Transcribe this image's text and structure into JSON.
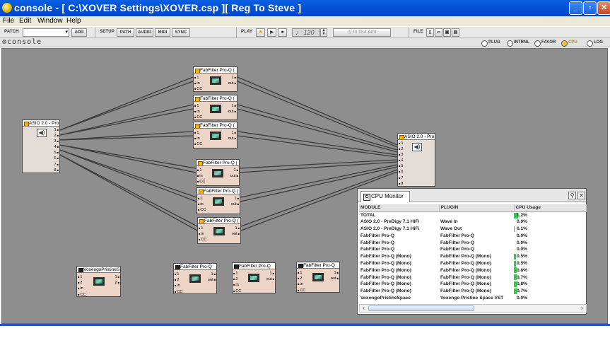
{
  "window": {
    "title": "console - [ C:\\XOVER Settings\\XOVER.csp ][ Reg To Steve ]",
    "buttons": [
      "_",
      "▫",
      "✕"
    ]
  },
  "menu": [
    "File",
    "Edit",
    "Window",
    "Help"
  ],
  "toolbar": {
    "patch_label": "PATCH",
    "add_label": "ADD",
    "setup_label": "SETUP",
    "path_label": "PATH",
    "audio_label": "AUDIO",
    "midi_label": "MIDI",
    "sync_label": "SYNC",
    "play_label": "PLAY",
    "tempo": "♩ 120",
    "inout_label": "In Out Amt",
    "file_label": "FILE"
  },
  "console": {
    "title": "console",
    "tabs": [
      "PLUG",
      "INTRNL",
      "FAVOR",
      "CPU",
      "LOG"
    ],
    "active_tab": "CPU"
  },
  "modules": [
    {
      "id": "asio-in",
      "title": "ASIO 2.0 - Pro",
      "outputs": [
        "1",
        "2",
        "3",
        "4",
        "5",
        "6",
        "7",
        "8"
      ]
    },
    {
      "id": "fab1",
      "title": "FabFilter Pro-Q (",
      "inputs": [
        "1",
        "in",
        "CC"
      ],
      "outputs": [
        "1",
        "out"
      ]
    },
    {
      "id": "fab2",
      "title": "FabFilter Pro-Q (",
      "inputs": [
        "1",
        "in",
        "CC"
      ],
      "outputs": [
        "1",
        "out"
      ]
    },
    {
      "id": "fab3",
      "title": "FabFilter Pro-Q (",
      "inputs": [
        "1",
        "in",
        "CC"
      ],
      "outputs": [
        "1",
        "out"
      ]
    },
    {
      "id": "fab4",
      "title": "FabFilter Pro-Q (",
      "inputs": [
        "1",
        "in",
        "CC"
      ],
      "outputs": [
        "1",
        "out"
      ]
    },
    {
      "id": "fab5",
      "title": "FabFilter Pro-Q (",
      "inputs": [
        "1",
        "in",
        "CC"
      ],
      "outputs": [
        "1",
        "out"
      ]
    },
    {
      "id": "fab6",
      "title": "FabFilter Pro-Q (",
      "inputs": [
        "1",
        "in",
        "CC"
      ],
      "outputs": [
        "1",
        "out"
      ]
    },
    {
      "id": "asio-out",
      "title": "ASIO 2.0 - Pro",
      "inputs": [
        "1",
        "2",
        "3",
        "4",
        "5",
        "6",
        "7",
        "8"
      ]
    },
    {
      "id": "voxengo",
      "title": "VoxengoPristineS",
      "inputs": [
        "1",
        "2",
        "in",
        "CC"
      ],
      "outputs": [
        "1",
        "2"
      ]
    },
    {
      "id": "fab7",
      "title": "FabFilter Pro-Q",
      "inputs": [
        "1",
        "2",
        "in",
        "CC"
      ],
      "outputs": [
        "1",
        "out"
      ]
    },
    {
      "id": "fab8",
      "title": "FabFilter Pro-Q",
      "inputs": [
        "1",
        "2",
        "in",
        "CC"
      ],
      "outputs": [
        "1",
        "out"
      ]
    },
    {
      "id": "fab9",
      "title": "FabFilter Pro-Q",
      "inputs": [
        "1",
        "2",
        "in",
        "CC"
      ],
      "outputs": [
        "1",
        "out"
      ]
    }
  ],
  "cpu_monitor": {
    "title": "CPU Monitor",
    "columns": [
      "MODULE",
      "PLUGIN",
      "CPU Usage"
    ],
    "rows": [
      {
        "module": "TOTAL",
        "plugin": "",
        "usage": "1.2%",
        "pct": 1.2
      },
      {
        "module": "ASIO 2.0 - PreDigy 7.1 HiFi",
        "plugin": "Wave In",
        "usage": "0.0%",
        "pct": 0
      },
      {
        "module": "ASIO 2.0 - PreDigy 7.1 HiFi",
        "plugin": "Wave Out",
        "usage": "0.1%",
        "pct": 0.1
      },
      {
        "module": "FabFilter Pro-Q",
        "plugin": "FabFilter Pro-Q",
        "usage": "0.0%",
        "pct": 0
      },
      {
        "module": "FabFilter Pro-Q",
        "plugin": "FabFilter Pro-Q",
        "usage": "0.0%",
        "pct": 0
      },
      {
        "module": "FabFilter Pro-Q",
        "plugin": "FabFilter Pro-Q",
        "usage": "0.0%",
        "pct": 0
      },
      {
        "module": "FabFilter Pro-Q (Mono)",
        "plugin": "FabFilter Pro-Q (Mono)",
        "usage": "0.5%",
        "pct": 0.5
      },
      {
        "module": "FabFilter Pro-Q (Mono)",
        "plugin": "FabFilter Pro-Q (Mono)",
        "usage": "0.5%",
        "pct": 0.5
      },
      {
        "module": "FabFilter Pro-Q (Mono)",
        "plugin": "FabFilter Pro-Q (Mono)",
        "usage": "0.8%",
        "pct": 0.8
      },
      {
        "module": "FabFilter Pro-Q (Mono)",
        "plugin": "FabFilter Pro-Q (Mono)",
        "usage": "0.7%",
        "pct": 0.7
      },
      {
        "module": "FabFilter Pro-Q (Mono)",
        "plugin": "FabFilter Pro-Q (Mono)",
        "usage": "0.8%",
        "pct": 0.8
      },
      {
        "module": "FabFilter Pro-Q (Mono)",
        "plugin": "FabFilter Pro-Q (Mono)",
        "usage": "0.7%",
        "pct": 0.7
      },
      {
        "module": "VoxengoPristineSpace",
        "plugin": "Voxengo Pristine Space VST",
        "usage": "0.0%",
        "pct": 0
      }
    ]
  },
  "colors": {
    "canvas": "#8e8e8e",
    "module_fill": "#ecd4c6",
    "usage_bar": "#2ecc40",
    "titlebar": "#0554d8"
  }
}
